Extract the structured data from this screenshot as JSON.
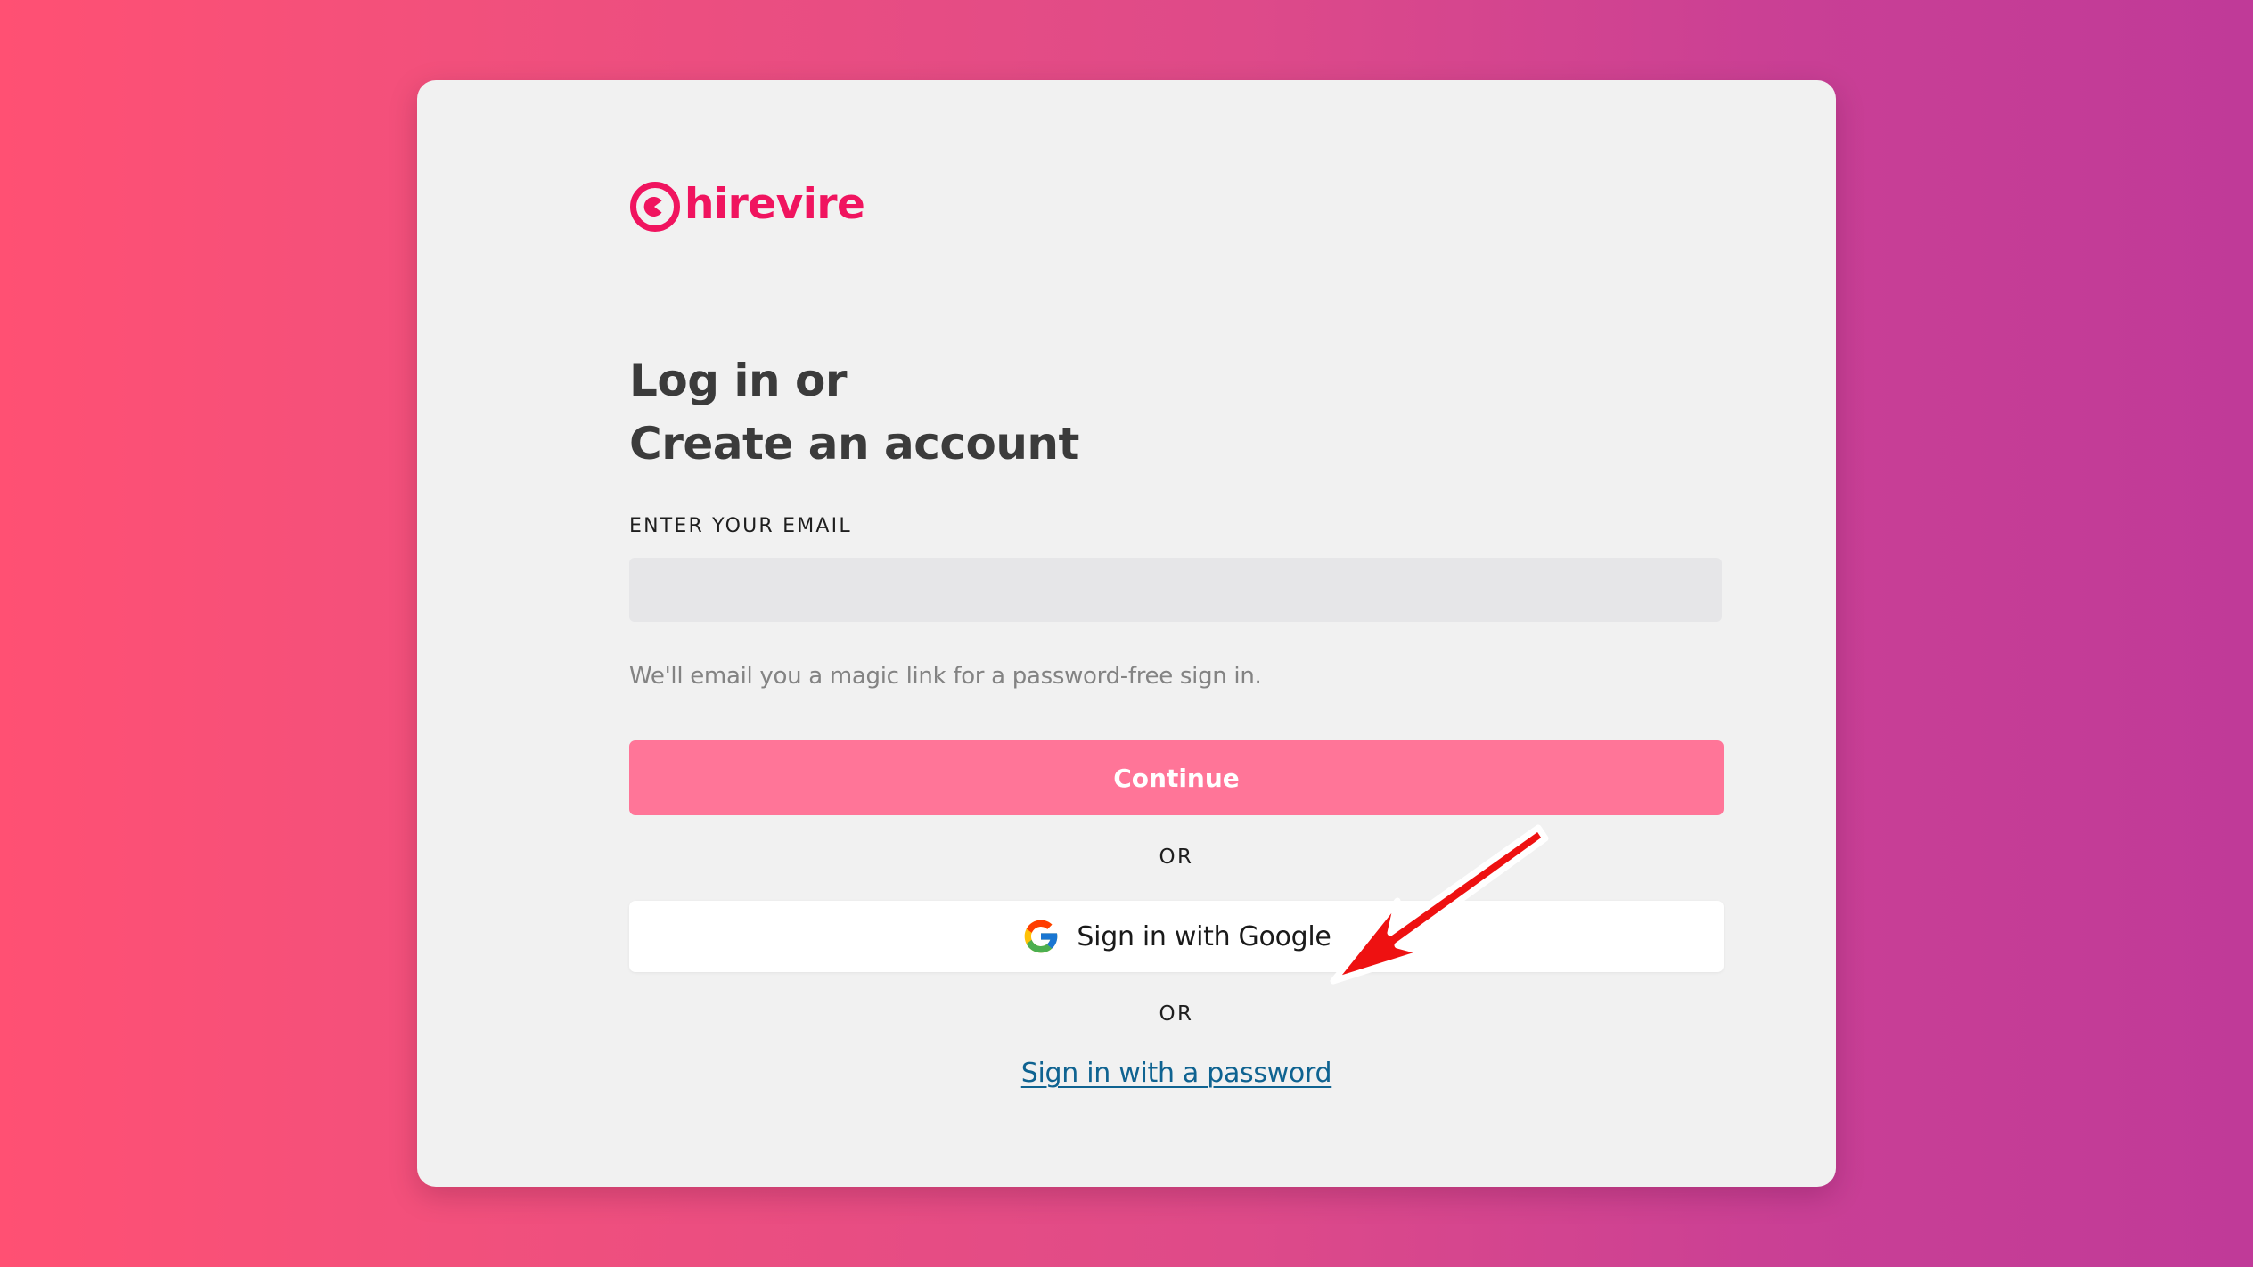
{
  "brand": {
    "name": "hirevire",
    "color": "#f0145f"
  },
  "login": {
    "heading_line1": "Log in or",
    "heading_line2": "Create an account",
    "email_label": "ENTER YOUR EMAIL",
    "email_value": "",
    "email_placeholder": "",
    "hint": "We'll email you a magic link for a password-free sign in.",
    "continue_label": "Continue",
    "or_label_1": "OR",
    "google_label": "Sign in with Google",
    "or_label_2": "OR",
    "password_link": "Sign in with a password"
  },
  "colors": {
    "continue_button": "#ff7598",
    "link": "#0f6391",
    "annotation_arrow": "#ee1111"
  },
  "icons": {
    "logo": "hirevire-logo-icon",
    "google": "google-g-icon",
    "annotation": "red-arrow-icon"
  }
}
